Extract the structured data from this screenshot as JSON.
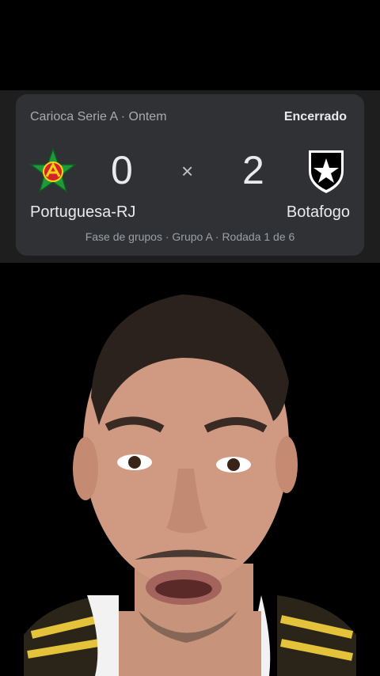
{
  "match": {
    "league": "Carioca Serie A · Ontem",
    "status": "Encerrado",
    "home_team": "Portuguesa-RJ",
    "away_team": "Botafogo",
    "home_score": "0",
    "away_score": "2",
    "separator": "×",
    "stage": "Fase de grupos · Grupo A · Rodada 1 de 6"
  },
  "colors": {
    "card_bg": "#303134",
    "text_primary": "#e8eaed",
    "text_secondary": "#a7aaaf",
    "home_crest_green": "#1f9a3a",
    "home_crest_red": "#d2232a",
    "home_crest_yellow": "#f7d117",
    "away_crest": "#000000"
  },
  "icons": {
    "home_crest": "portuguesa-star-crest-icon",
    "away_crest": "botafogo-star-shield-icon"
  }
}
